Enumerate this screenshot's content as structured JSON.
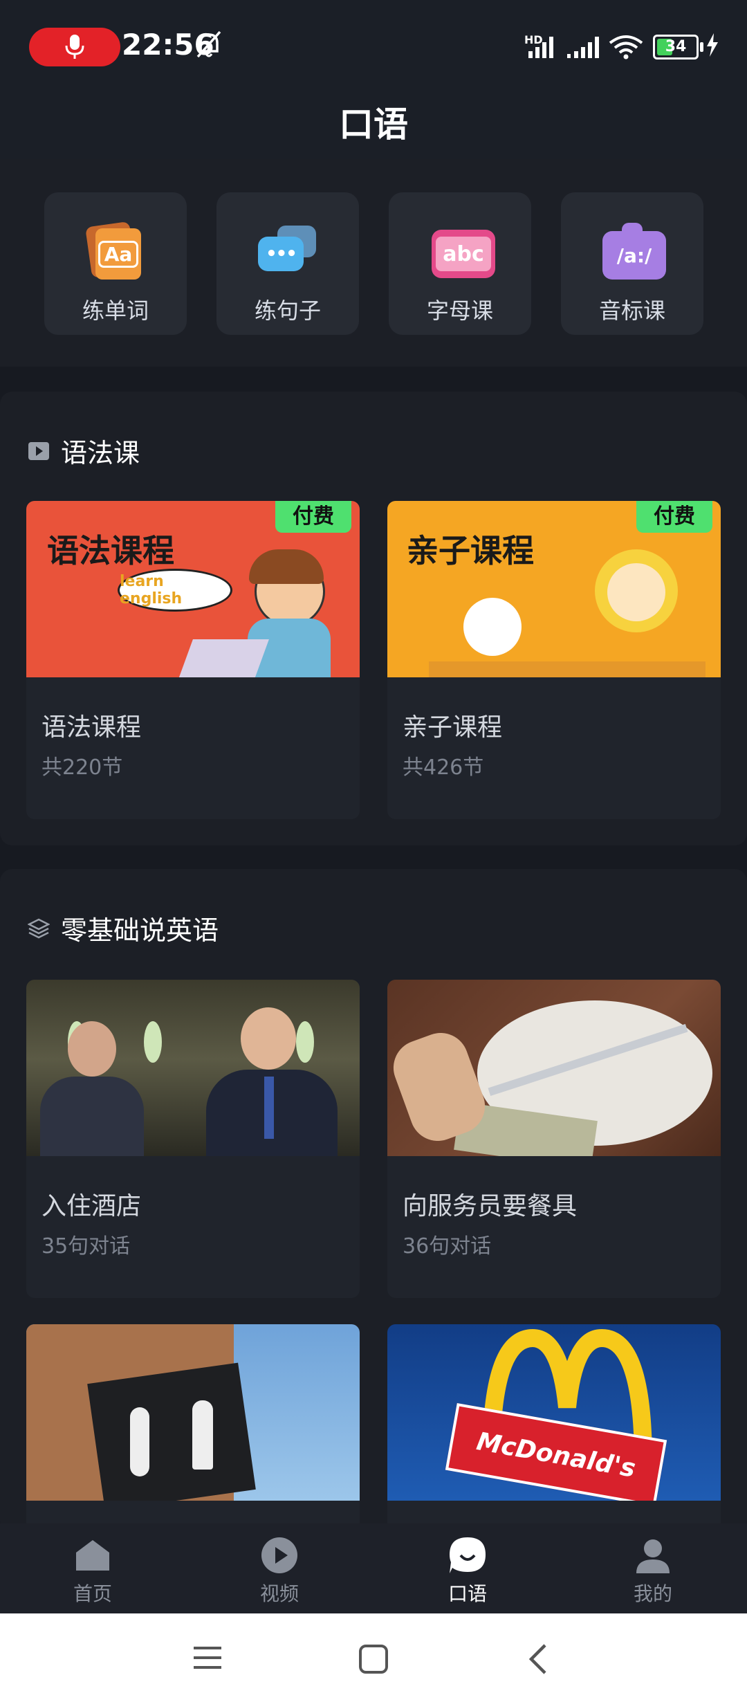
{
  "status_bar": {
    "time": "22:56",
    "battery": "34",
    "network_label": "HD"
  },
  "header": {
    "title": "口语"
  },
  "quick_tiles": [
    {
      "label": "练单词",
      "icon": "word-card-icon",
      "icon_text": "Aa"
    },
    {
      "label": "练句子",
      "icon": "chat-bubbles-icon",
      "icon_text": "•••"
    },
    {
      "label": "字母课",
      "icon": "abc-icon",
      "icon_text": "abc"
    },
    {
      "label": "音标课",
      "icon": "phonetic-icon",
      "icon_text": "/a:/"
    }
  ],
  "grammar_section": {
    "title": "语法课",
    "cards": [
      {
        "title": "语法课程",
        "subtitle": "共220节",
        "badge": "付费",
        "thumb_title": "语法课程",
        "thumb_bubble": "learn english"
      },
      {
        "title": "亲子课程",
        "subtitle": "共426节",
        "badge": "付费",
        "thumb_title": "亲子课程"
      }
    ]
  },
  "beginner_section": {
    "title": "零基础说英语",
    "cards": [
      {
        "title": "入住酒店",
        "subtitle": "35句对话"
      },
      {
        "title": "向服务员要餐具",
        "subtitle": "36句对话"
      },
      {
        "title": "",
        "subtitle": ""
      },
      {
        "title": "",
        "subtitle": "",
        "thumb_sign": "McDonald's"
      }
    ]
  },
  "bottom_nav": [
    {
      "label": "首页",
      "icon": "home-icon",
      "active": false
    },
    {
      "label": "视频",
      "icon": "video-play-icon",
      "active": false
    },
    {
      "label": "口语",
      "icon": "speech-bubble-icon",
      "active": true
    },
    {
      "label": "我的",
      "icon": "profile-icon",
      "active": false
    }
  ],
  "colors": {
    "background": "#171a21",
    "badge_green": "#4fe06f",
    "recording_red": "#e32228",
    "grammar_thumb": "#e9533a",
    "parent_thumb": "#f5a623"
  }
}
